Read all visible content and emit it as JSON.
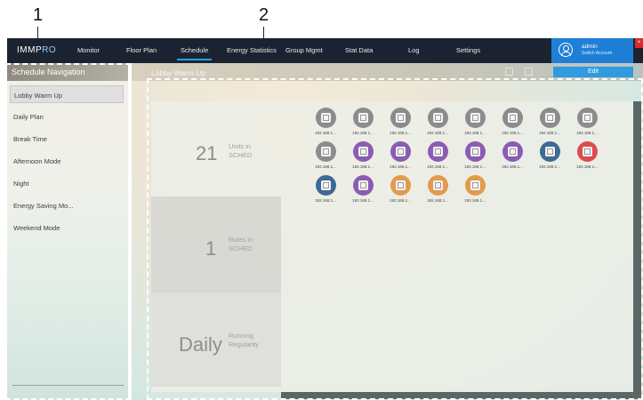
{
  "callouts": [
    "1",
    "2"
  ],
  "app": {
    "logo_main": "IMMP",
    "logo_accent": "RO"
  },
  "nav": {
    "items": [
      "Monitor",
      "Floor Plan",
      "Schedule",
      "Energy Statistics",
      "Group Mgmt",
      "Stat Data",
      "Log",
      "Settings"
    ],
    "active": "Schedule"
  },
  "account": {
    "name": "admin",
    "sub": "Switch Account"
  },
  "sidebar": {
    "title": "Schedule Navigation",
    "items": [
      "Lobby Warm Up",
      "Daily Plan",
      "Break Time",
      "Afternoon Mode",
      "Night",
      "Energy Saving Mo...",
      "Weekend Mode"
    ],
    "selected": "Lobby Warm Up"
  },
  "main": {
    "title": "Lobby Warm Up",
    "edit_label": "Edit",
    "stats": [
      {
        "value": "21",
        "label_1": "Units in",
        "label_2": "SCHED"
      },
      {
        "value": "1",
        "label_1": "Rules in",
        "label_2": "SCHED"
      },
      {
        "value": "Daily",
        "label_1": "Running",
        "label_2": "Regularity"
      }
    ]
  },
  "units": [
    {
      "ip": "192.168.1...",
      "status_color": "gray"
    },
    {
      "ip": "192.168.1...",
      "status_color": "gray"
    },
    {
      "ip": "192.168.1...",
      "status_color": "gray"
    },
    {
      "ip": "192.168.1...",
      "status_color": "gray"
    },
    {
      "ip": "192.168.1...",
      "status_color": "gray"
    },
    {
      "ip": "192.168.1...",
      "status_color": "gray"
    },
    {
      "ip": "192.168.1...",
      "status_color": "gray"
    },
    {
      "ip": "192.168.1...",
      "status_color": "gray"
    },
    {
      "ip": "192.168.1...",
      "status_color": "gray"
    },
    {
      "ip": "192.168.1...",
      "status_color": "purple"
    },
    {
      "ip": "192.168.1...",
      "status_color": "purple"
    },
    {
      "ip": "192.168.1...",
      "status_color": "purple"
    },
    {
      "ip": "192.168.1...",
      "status_color": "purple"
    },
    {
      "ip": "192.168.1...",
      "status_color": "purple"
    },
    {
      "ip": "192.168.1...",
      "status_color": "navy"
    },
    {
      "ip": "192.168.1...",
      "status_color": "red"
    },
    {
      "ip": "192.168.1...",
      "status_color": "navy"
    },
    {
      "ip": "192.168.1...",
      "status_color": "purple"
    },
    {
      "ip": "192.168.1...",
      "status_color": "orange"
    },
    {
      "ip": "192.168.1...",
      "status_color": "orange"
    },
    {
      "ip": "192.168.1...",
      "status_color": "orange"
    }
  ],
  "colors": {
    "gray": "#8c8c8c",
    "purple": "#8c5bb3",
    "navy": "#3e6a93",
    "red": "#e04a4a",
    "orange": "#e39a4d",
    "accent": "#2f9be0",
    "topbar": "#1b2331"
  }
}
